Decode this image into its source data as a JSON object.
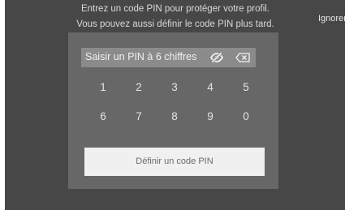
{
  "prompt": {
    "line1": "Entrez un code PIN pour protéger votre profil.",
    "line2": "Vous pouvez aussi définir le code PIN plus tard."
  },
  "header": {
    "skip_label": "Ignorer"
  },
  "pin_field": {
    "placeholder": "Saisir un PIN à 6 chiffres",
    "eye_icon": "eye-slash-icon",
    "backspace_icon": "backspace-icon"
  },
  "keypad": {
    "row1": [
      "1",
      "2",
      "3",
      "4",
      "5"
    ],
    "row2": [
      "6",
      "7",
      "8",
      "9",
      "0"
    ]
  },
  "actions": {
    "submit_label": "Définir un code PIN"
  },
  "colors": {
    "background": "#474747",
    "dialog": "#676767",
    "field": "#8b8b8b",
    "button": "#f0f0f0"
  }
}
